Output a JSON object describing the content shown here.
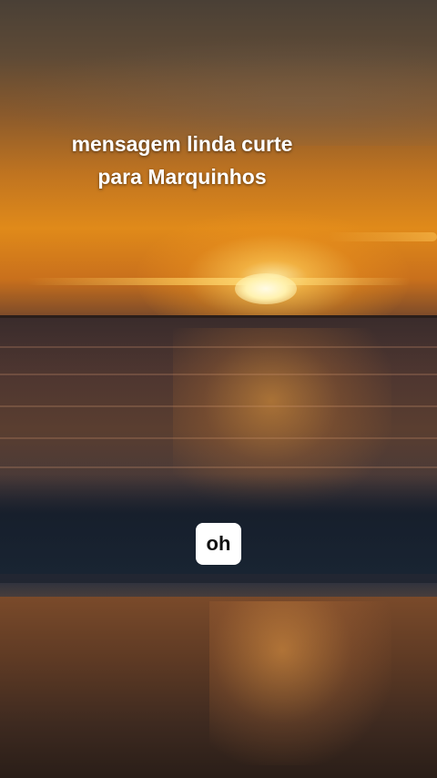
{
  "caption": {
    "line1": "mensagem linda curte",
    "line2": "para Marquinhos"
  },
  "sticker": {
    "text": "oh"
  },
  "scene": {
    "description_key": "sunset-beach-video-frame",
    "colors": {
      "sky_top": "#4a4036",
      "sky_glow": "#e08a1a",
      "sun": "#fff2b0",
      "sea": "#4a3a38",
      "surf": "#1e2430",
      "sand": "#5e3a24"
    }
  }
}
